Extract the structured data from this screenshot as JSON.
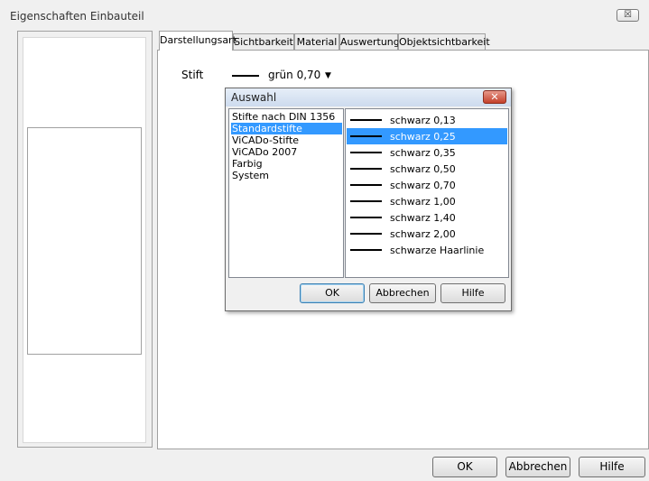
{
  "window": {
    "title": "Eigenschaften Einbauteil",
    "close_label": "☒"
  },
  "tabs": [
    "Darstellungsart",
    "Sichtbarkeit",
    "Material",
    "Auswertung",
    "Objektsichtbarkeit"
  ],
  "stift": {
    "label": "Stift",
    "value": "grün 0,70",
    "arrow": "▼"
  },
  "buttons": {
    "ok": "OK",
    "cancel": "Abbrechen",
    "help": "Hilfe"
  },
  "dialog": {
    "title": "Auswahl",
    "close_label": "✕",
    "categories": [
      "Stifte nach DIN 1356",
      "Standardstifte",
      "ViCADo-Stifte",
      "ViCADo 2007",
      "Farbig",
      "System"
    ],
    "selected_category": "Standardstifte",
    "pens": [
      "schwarz 0,13",
      "schwarz 0,25",
      "schwarz 0,35",
      "schwarz 0,50",
      "schwarz 0,70",
      "schwarz 1,00",
      "schwarz 1,40",
      "schwarz 2,00",
      "schwarze Haarlinie"
    ],
    "selected_pen": "schwarz 0,25",
    "buttons": {
      "ok": "OK",
      "cancel": "Abbrechen",
      "help": "Hilfe"
    }
  }
}
